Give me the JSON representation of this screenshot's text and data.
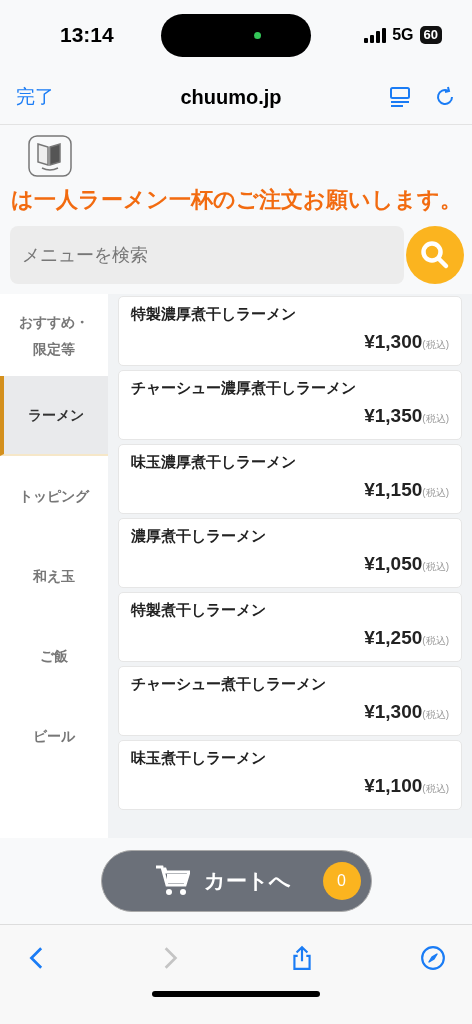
{
  "status_bar": {
    "time": "13:14",
    "network": "5G",
    "battery": "60"
  },
  "browser_bar": {
    "done": "完了",
    "url": "chuumo.jp"
  },
  "notice": "は一人ラーメン一杯のご注文お願いします。",
  "search": {
    "placeholder": "メニューを検索"
  },
  "categories": [
    {
      "label": "おすすめ・限定等",
      "selected": false
    },
    {
      "label": "ラーメン",
      "selected": true
    },
    {
      "label": "トッピング",
      "selected": false
    },
    {
      "label": "和え玉",
      "selected": false
    },
    {
      "label": "ご飯",
      "selected": false
    },
    {
      "label": "ビール",
      "selected": false
    }
  ],
  "menu_items": [
    {
      "name": "特製濃厚煮干しラーメン",
      "price": "¥1,300",
      "tax": "(税込)"
    },
    {
      "name": "チャーシュー濃厚煮干しラーメン",
      "price": "¥1,350",
      "tax": "(税込)"
    },
    {
      "name": "味玉濃厚煮干しラーメン",
      "price": "¥1,150",
      "tax": "(税込)"
    },
    {
      "name": "濃厚煮干しラーメン",
      "price": "¥1,050",
      "tax": "(税込)"
    },
    {
      "name": "特製煮干しラーメン",
      "price": "¥1,250",
      "tax": "(税込)"
    },
    {
      "name": "チャーシュー煮干しラーメン",
      "price": "¥1,300",
      "tax": "(税込)"
    },
    {
      "name": "味玉煮干しラーメン",
      "price": "¥1,100",
      "tax": "(税込)"
    }
  ],
  "cart": {
    "label": "カートへ",
    "count": "0"
  },
  "toolbar": [
    {
      "kind": "back",
      "disabled": false
    },
    {
      "kind": "forward",
      "disabled": true
    },
    {
      "kind": "share",
      "disabled": false
    },
    {
      "kind": "compass",
      "disabled": false
    }
  ]
}
